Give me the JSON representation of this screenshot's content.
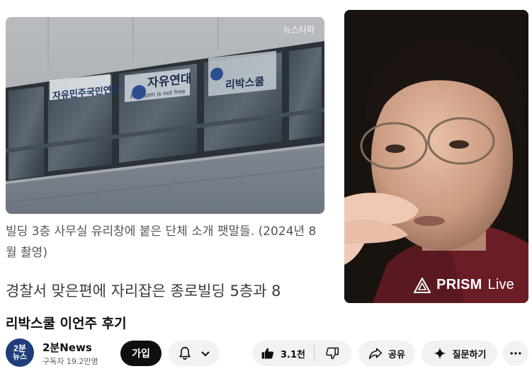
{
  "video": {
    "photo_signs": [
      "자유민주국민연합",
      "자유연대",
      "Freedom is not free",
      "리박스쿨",
      "뉴스타파"
    ],
    "caption": "빌딩 3층 사무실 유리창에 붙은 단체 소개 팻말들. (2024년 8월 촬영)",
    "caption_line1": "빌딩 3층 사무실 유리창에 붙은 단체 소개 팻말들. (2024년 8",
    "caption_line2": "월 촬영)",
    "body_text": "경찰서 맞은편에 자리잡은 종로빌딩 5층과 8",
    "overlay_brand": "PRISM",
    "overlay_live": "Live"
  },
  "title": "리박스쿨 이언주 후기",
  "channel": {
    "avatar_line1": "2분",
    "avatar_line2": "뉴스",
    "name": "2분News",
    "subscribers": "구독자 19.2만명",
    "join_label": "가입"
  },
  "actions": {
    "like_count": "3.1천",
    "share_label": "공유",
    "ask_label": "질문하기"
  },
  "icons": [
    "bell-icon",
    "chevron-down-icon",
    "thumbs-up-icon",
    "thumbs-down-icon",
    "share-icon",
    "sparkle-icon",
    "more-icon",
    "prism-logo-icon"
  ],
  "colors": {
    "join_bg": "#0f0f0f",
    "pill_bg": "#f2f2f2",
    "avatar_bg": "#1e3d7a"
  }
}
